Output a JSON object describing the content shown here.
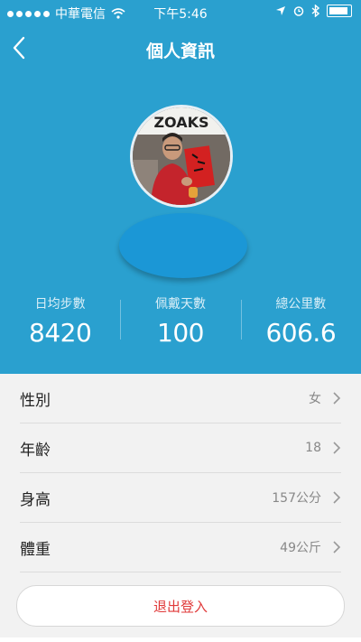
{
  "status": {
    "carrier": "中華電信",
    "time": "下午5:46"
  },
  "nav": {
    "title": "個人資訊"
  },
  "avatar": {
    "shirt_text": "ZOAKS"
  },
  "stats": [
    {
      "label": "日均步數",
      "value": "8420"
    },
    {
      "label": "佩戴天數",
      "value": "100"
    },
    {
      "label": "總公里數",
      "value": "606.6"
    }
  ],
  "rows": [
    {
      "label": "性別",
      "value": "女"
    },
    {
      "label": "年齡",
      "value": "18"
    },
    {
      "label": "身高",
      "value": "157公分"
    },
    {
      "label": "體重",
      "value": "49公斤"
    }
  ],
  "logout_label": "退出登入",
  "colors": {
    "header": "#2aa0cf",
    "accent_red": "#e03a3a"
  }
}
